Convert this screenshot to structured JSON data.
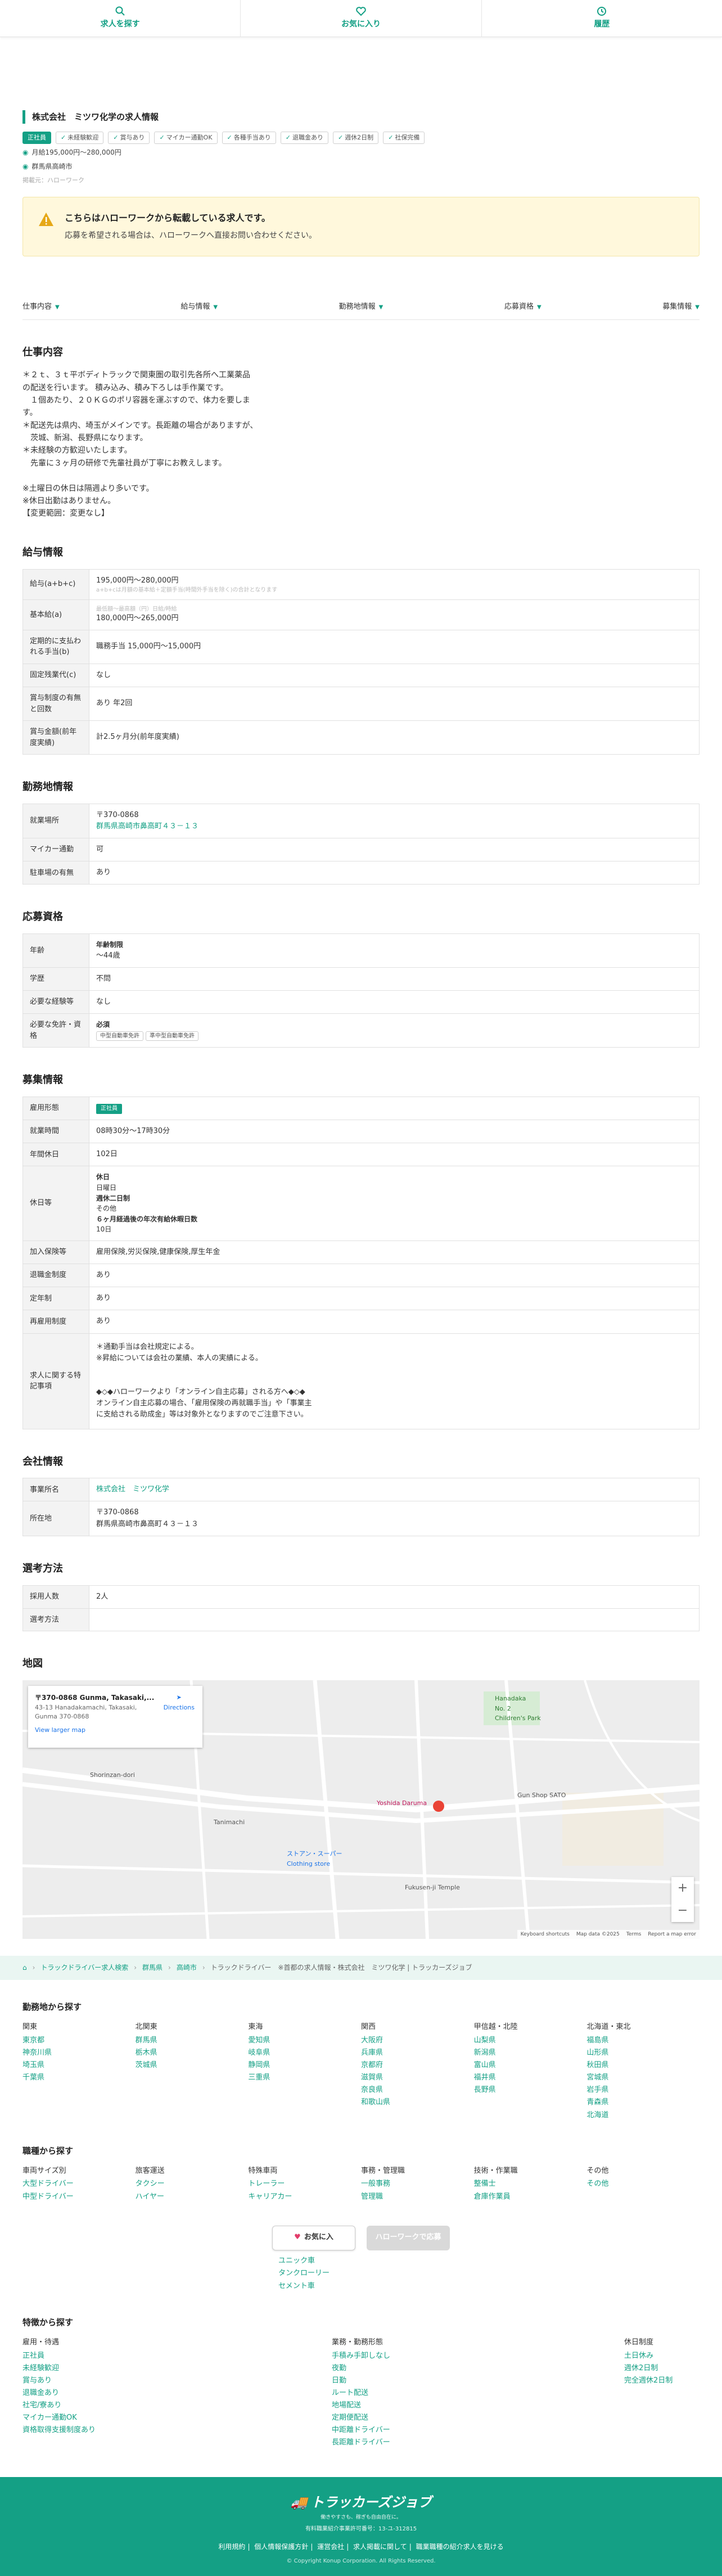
{
  "nav": {
    "search": "求人を探す",
    "favorites": "お気に入り",
    "history": "履歴"
  },
  "header": {
    "company_title": "株式会社　ミツワ化学の求人情報",
    "tags": [
      "正社員",
      "未経験歓迎",
      "賞与あり",
      "マイカー通勤OK",
      "各種手当あり",
      "退職金あり",
      "週休2日制",
      "社保完備"
    ],
    "salary": "月給195,000円〜280,000円",
    "location": "群馬県高崎市",
    "posted": "掲載元：ハローワーク"
  },
  "notice": {
    "title": "こちらはハローワークから転載している求人です。",
    "body": "応募を希望される場合は、ハローワークへ直接お問い合わせください。"
  },
  "tabs": [
    "仕事内容",
    "給与情報",
    "勤務地情報",
    "応募資格",
    "募集情報"
  ],
  "job": {
    "title": "仕事内容",
    "description": "＊２ｔ、３ｔ平ボディトラックで関東圏の取引先各所へ工業薬品\nの配送を行います。 積み込み、積み下ろしは手作業です。\n　１個あたり、２０ＫＧのポリ容器を運ぶすので、体力を要しま\nす。\n＊配送先は県内、埼玉がメインです。長距離の場合がありますが、\n　茨城、新潟、長野県になります。\n＊未経験の方歓迎いたします。\n　先輩に３ヶ月の研修で先輩社員が丁寧にお教えします。\n\n※土曜日の休日は隔週より多いです。\n※休日出勤はありません。\n【変更範囲：変更なし】"
  },
  "salary": {
    "title": "給与情報",
    "rows": [
      {
        "th": "給与(a+b+c)",
        "value": "195,000円〜280,000円",
        "note": "a+b+cは月額の基本給＋定額手当(時間外手当を除く)の合計となります"
      },
      {
        "th": "基本給(a)",
        "note": "最低額〜最高額（円）日給/時給",
        "value": "180,000円〜265,000円"
      },
      {
        "th": "定期的に支払われる手当(b)",
        "value": "職務手当 15,000円〜15,000円"
      },
      {
        "th": "固定残業代(c)",
        "value": "なし"
      },
      {
        "th": "賞与制度の有無と回数",
        "value": "あり 年2回"
      },
      {
        "th": "賞与金額(前年度実績)",
        "value": "計2.5ヶ月分(前年度実績)"
      }
    ]
  },
  "location": {
    "title": "勤務地情報",
    "zip": "〒370-0868",
    "address": "群馬県高崎市鼻高町４３－１３",
    "rows": [
      {
        "th": "就業場所"
      },
      {
        "th": "マイカー通勤",
        "value": "可"
      },
      {
        "th": "駐車場の有無",
        "value": "あり"
      }
    ]
  },
  "qualification": {
    "title": "応募資格",
    "age_label": "年齢制限",
    "age_value": "〜44歳",
    "education": "不問",
    "experience": "なし",
    "license_label": "必須",
    "licenses": [
      "中型自動車免許",
      "準中型自動車免許"
    ],
    "th": [
      "年齢",
      "学歴",
      "必要な経験等",
      "必要な免許・資格"
    ]
  },
  "recruit": {
    "title": "募集情報",
    "th": [
      "雇用形態",
      "就業時間",
      "年間休日",
      "休日等",
      "加入保険等",
      "退職金制度",
      "定年制",
      "再雇用制度",
      "求人に関する特記事項"
    ],
    "employment": "正社員",
    "hours": "08時30分〜17時30分",
    "annual_holidays": "102日",
    "holiday_lines": [
      "休日",
      "日曜日",
      "週休二日制",
      "その他",
      "６ヶ月経過後の年次有給休暇日数",
      "10日"
    ],
    "insurance": "雇用保険,労災保険,健康保険,厚生年金",
    "retirement": "あり",
    "retire_age": "あり",
    "reemployment": "あり",
    "remarks": "＊通勤手当は会社規定による。\n※昇給については会社の業績、本人の実績による。\n\n\n◆◇◆ハローワークより「オンライン自主応募」される方へ◆◇◆\nオンライン自主応募の場合、「雇用保険の再就職手当」や「事業主\nに支給される助成金」等は対象外となりますのでご注意下さい。"
  },
  "company": {
    "title": "会社情報",
    "th": [
      "事業所名",
      "所在地"
    ],
    "name": "株式会社　ミツワ化学",
    "zip": "〒370-0868",
    "address": "群馬県高崎市鼻高町４３－１３"
  },
  "selection": {
    "title": "選考方法",
    "th": [
      "採用人数",
      "選考方法"
    ],
    "count": "2人",
    "method": ""
  },
  "map": {
    "title": "地図",
    "card_title": "〒370-0868 Gunma, Takasaki,...",
    "card_addr": "43-13 Hanadakamachi, Takasaki,\nGunma 370-0868",
    "directions": "Directions",
    "larger": "View larger map",
    "labels": [
      "Hanadaka\nNo. 2\nChildren's Park",
      "Gun Shop SATO",
      "Yoshida Daruma",
      "ストアン・スーパー\nClothing store",
      "Fukusen-ji Temple",
      "Shorinzan-dori",
      "Tanimachi",
      "Keyboard shortcuts",
      "Map data ©2025",
      "Terms",
      "Report a map error"
    ],
    "zoom_in": "+",
    "zoom_out": "−"
  },
  "breadcrumb": [
    "トラックドライバー求人検索",
    "群馬県",
    "高崎市",
    "トラックドライバー　※首都の求人情報・株式会社　ミツワ化学 | トラッカーズジョブ"
  ],
  "area_search": {
    "title": "勤務地から探す",
    "columns": [
      {
        "head": "関東",
        "items": [
          "東京都",
          "神奈川県",
          "埼玉県",
          "千葉県"
        ]
      },
      {
        "head": "北関東",
        "items": [
          "群馬県",
          "栃木県",
          "茨城県"
        ]
      },
      {
        "head": "東海",
        "items": [
          "愛知県",
          "岐阜県",
          "静岡県",
          "三重県"
        ]
      },
      {
        "head": "関西",
        "items": [
          "大阪府",
          "兵庫県",
          "京都府",
          "滋賀県",
          "奈良県",
          "和歌山県"
        ]
      },
      {
        "head": "甲信越・北陸",
        "items": [
          "山梨県",
          "新潟県",
          "富山県",
          "福井県",
          "長野県"
        ]
      },
      {
        "head": "北海道・東北",
        "items": [
          "福島県",
          "山形県",
          "秋田県",
          "宮城県",
          "岩手県",
          "青森県",
          "北海道"
        ]
      }
    ]
  },
  "job_search": {
    "title": "職種から探す",
    "columns": [
      {
        "head": "車両サイズ別",
        "items": [
          "大型ドライバー",
          "中型ドライバー"
        ]
      },
      {
        "head": "旅客運送",
        "items": [
          "タクシー",
          "ハイヤー"
        ]
      },
      {
        "head": "特殊車両",
        "items": [
          "トレーラー",
          "キャリアカー"
        ]
      },
      {
        "head": "事務・管理職",
        "items": [
          "一般事務",
          "管理職"
        ]
      },
      {
        "head": "技術・作業職",
        "items": [
          "整備士",
          "倉庫作業員"
        ]
      },
      {
        "head": "その他",
        "items": [
          "その他"
        ]
      }
    ]
  },
  "buttons": {
    "favorite": "お気に入",
    "apply": "ハローワークで応募"
  },
  "mid_list": [
    "ユニック車",
    "タンクローリー",
    "セメント車"
  ],
  "feature_search": {
    "title": "特徴から探す",
    "columns": [
      {
        "head": "雇用・待遇",
        "items": [
          "正社員",
          "未経験歓迎",
          "賞与あり",
          "退職金あり",
          "社宅/寮あり",
          "マイカー通勤OK",
          "資格取得支援制度あり"
        ]
      },
      {
        "head": "業務・勤務形態",
        "items": [
          "手積み手卸しなし",
          "夜勤",
          "日勤",
          "ルート配送",
          "地場配送",
          "定期便配送",
          "中距離ドライバー",
          "長距離ドライバー"
        ]
      },
      {
        "head": "休日制度",
        "items": [
          "土日休み",
          "週休2日制",
          "完全週休2日制"
        ]
      }
    ]
  },
  "footer": {
    "logo": "トラッカーズジョブ",
    "tagline": "働きやすさも、稼ぎも自由自在に。",
    "license": "有料職業紹介事業許可番号：13-ユ-312815",
    "links": [
      "利用規約",
      "個人情報保護方針",
      "運営会社",
      "求人掲載に関して",
      "職業職種の紹介求人を見ける"
    ],
    "copyright": "© Copyright Konup Corporation. All Rights Reserved."
  },
  "colors": {
    "accent": "#14a085",
    "notice_bg": "#fff8dc"
  }
}
